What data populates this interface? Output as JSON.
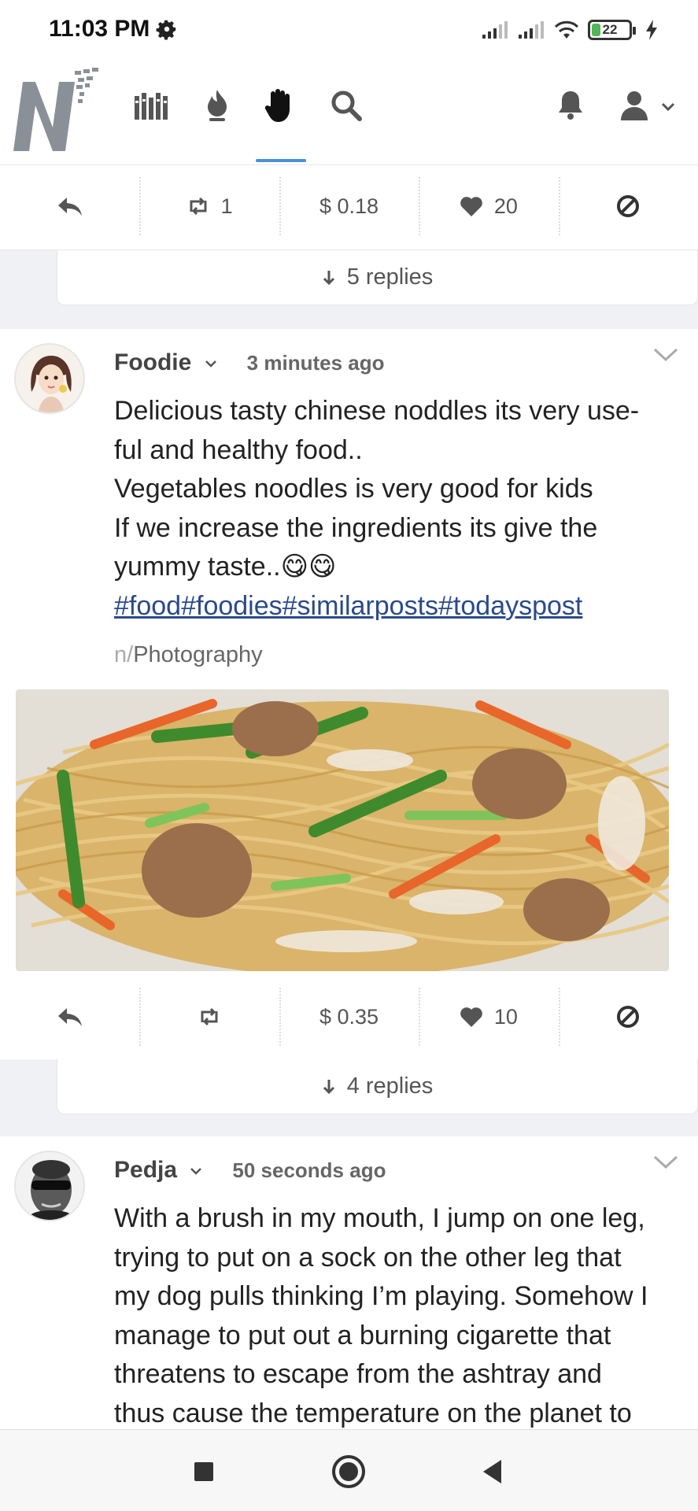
{
  "status_bar": {
    "time": "11:03 PM",
    "battery": "22",
    "battery_level_percent": 22,
    "icons": [
      "gear-icon",
      "signal-icon",
      "signal-icon",
      "wifi-icon",
      "battery-icon",
      "charging-icon"
    ]
  },
  "header": {
    "logo_icon": "logo-icon",
    "nav_icons": [
      "library-icon",
      "flame-icon",
      "hand-icon",
      "search-icon"
    ],
    "active_nav": "hand-icon",
    "right_icons": [
      "bell-icon",
      "user-icon",
      "chevron-down-icon"
    ],
    "accent_color": "#4a90d9"
  },
  "previous_post": {
    "actions": {
      "reshare_count": "1",
      "value": "$ 0.18",
      "likes": "20"
    },
    "replies": "5 replies"
  },
  "post1": {
    "username": "Foodie",
    "timestamp": "3 minutes ago",
    "body_lines": [
      "Delicious tasty chinese noddles its very use-",
      "ful and healthy food..",
      "Vegetables noodles is very good for kids",
      "If we increase the ingredients its give the",
      "yummy taste..😋😋"
    ],
    "hashtags": "#food#foodies#similarposts#todayspost",
    "community_prefix": "n/",
    "community": "Photography",
    "image_icon": "noodles-photo",
    "actions": {
      "value": "$ 0.35",
      "likes": "10"
    },
    "replies": "4 replies"
  },
  "post2": {
    "username": "Pedja",
    "timestamp": "50 seconds ago",
    "body_lines": [
      "With a brush in my mouth, I jump on one leg,",
      "trying to put on a sock on the other leg that",
      "my dog pulls thinking I’m playing. Somehow I",
      "manage to put out a burning cigarette that",
      "threatens to escape from the ashtray and",
      "thus cause the temperature on the planet to"
    ]
  },
  "system_nav": {
    "icons": [
      "recents-icon",
      "home-icon",
      "back-icon"
    ]
  }
}
